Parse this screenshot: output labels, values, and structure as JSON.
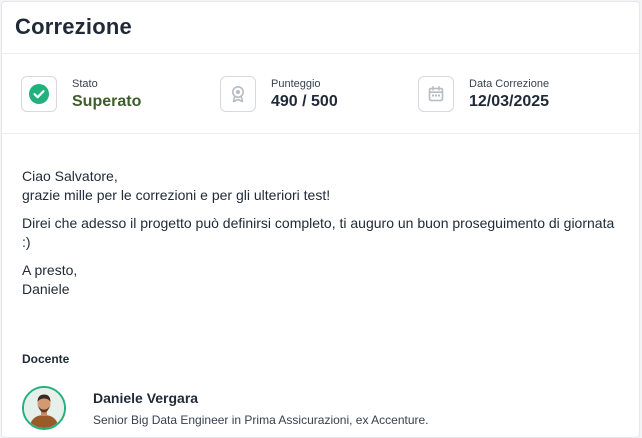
{
  "header": {
    "title": "Correzione"
  },
  "stats": [
    {
      "label": "Stato",
      "value": "Superato",
      "icon": "check-circle-icon"
    },
    {
      "label": "Punteggio",
      "value": "490 / 500",
      "icon": "award-icon"
    },
    {
      "label": "Data Correzione",
      "value": "12/03/2025",
      "icon": "calendar-icon"
    }
  ],
  "message": {
    "p1": "Ciao Salvatore,\ngrazie mille per le correzioni e per gli ulteriori test!",
    "p2": "Direi che adesso il progetto può definirsi completo, ti auguro un buon proseguimento di giornata :)",
    "p3": "A presto,\nDaniele"
  },
  "teacher": {
    "section_label": "Docente",
    "name": "Daniele Vergara",
    "role": "Senior Big Data Engineer in Prima Assicurazioni, ex Accenture."
  },
  "colors": {
    "success": "#22b07d",
    "success_text": "#3f5d2c"
  }
}
